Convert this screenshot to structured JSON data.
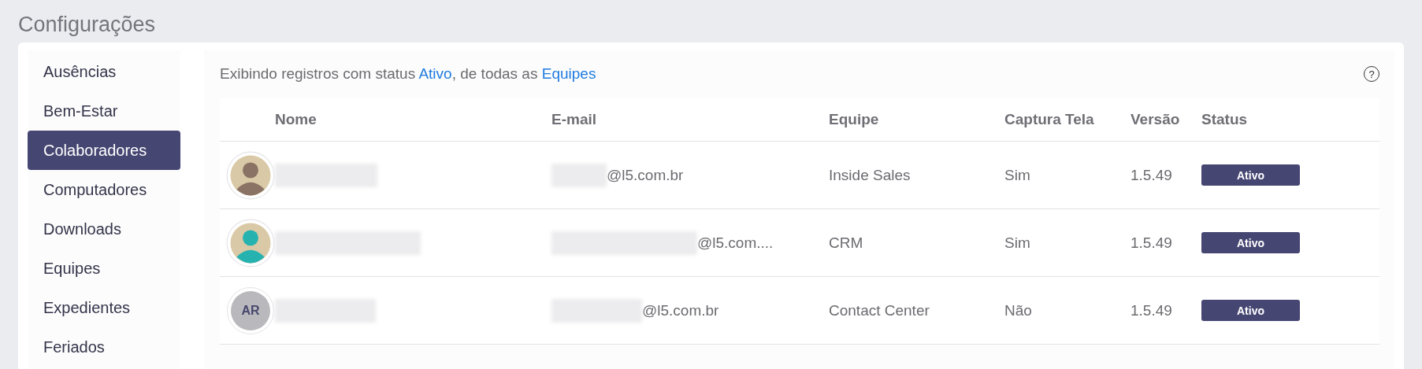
{
  "page_title": "Configurações",
  "sidebar": {
    "items": [
      {
        "label": "Ausências",
        "selected": false
      },
      {
        "label": "Bem-Estar",
        "selected": false
      },
      {
        "label": "Colaboradores",
        "selected": true
      },
      {
        "label": "Computadores",
        "selected": false
      },
      {
        "label": "Downloads",
        "selected": false
      },
      {
        "label": "Equipes",
        "selected": false
      },
      {
        "label": "Expedientes",
        "selected": false
      },
      {
        "label": "Feriados",
        "selected": false
      }
    ]
  },
  "filter_summary": {
    "prefix": "Exibindo registros com status ",
    "status_link": "Ativo",
    "middle": ", de todas as ",
    "team_link": "Equipes"
  },
  "help_icon": "?",
  "table": {
    "columns": [
      "Nome",
      "E-mail",
      "Equipe",
      "Captura Tela",
      "Versão",
      "Status"
    ],
    "rows": [
      {
        "avatar": {
          "kind": "photo",
          "color": "#8a7264"
        },
        "email_domain": "@l5.com.br",
        "team": "Inside Sales",
        "screen_capture": "Sim",
        "version": "1.5.49",
        "status": "Ativo"
      },
      {
        "avatar": {
          "kind": "photo",
          "color": "#26b3b0"
        },
        "email_domain": "@l5.com....",
        "team": "CRM",
        "screen_capture": "Sim",
        "version": "1.5.49",
        "status": "Ativo"
      },
      {
        "avatar": {
          "kind": "initials",
          "initials": "AR"
        },
        "email_domain": "@l5.com.br",
        "team": "Contact Center",
        "screen_capture": "Não",
        "version": "1.5.49",
        "status": "Ativo"
      }
    ]
  }
}
